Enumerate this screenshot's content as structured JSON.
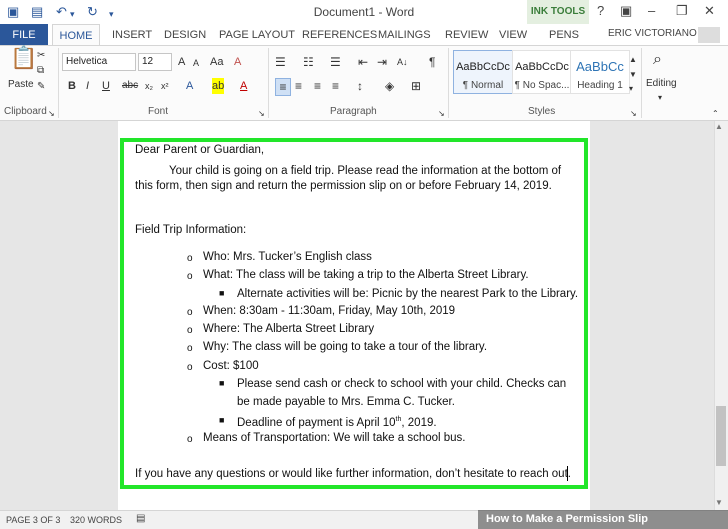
{
  "title_bar": {
    "document_title": "Document1 - Word",
    "ink_tools": "INK TOOLS",
    "help": "?"
  },
  "tabs": [
    "FILE",
    "HOME",
    "INSERT",
    "DESIGN",
    "PAGE LAYOUT",
    "REFERENCES",
    "MAILINGS",
    "REVIEW",
    "VIEW",
    "PENS"
  ],
  "user": "ERIC VICTORIANO",
  "ribbon": {
    "clipboard": {
      "paste_label": "Paste",
      "group_label": "Clipboard"
    },
    "font": {
      "font_name": "Helvetica",
      "font_size": "12",
      "bold": "B",
      "italic": "I",
      "underline": "U",
      "group_label": "Font"
    },
    "paragraph": {
      "group_label": "Paragraph"
    },
    "styles": {
      "items": [
        {
          "sample": "AaBbCcDc",
          "name": "¶ Normal"
        },
        {
          "sample": "AaBbCcDc",
          "name": "¶ No Spac..."
        },
        {
          "sample": "AaBbCc",
          "name": "Heading 1"
        }
      ],
      "group_label": "Styles"
    },
    "editing": {
      "label": "Editing"
    }
  },
  "document": {
    "salutation": "Dear Parent or Guardian,",
    "intro_line1": "Your child is going on a field trip. Please read the information at the bottom of",
    "intro_line2": "this form, then sign and return the permission slip on or before February 14, 2019.",
    "section_heading": "Field Trip Information:",
    "who": "Who: Mrs. Tucker’s English class",
    "what": "What: The class will be taking a trip to the Alberta Street Library.",
    "alternate": "Alternate activities will be: Picnic by the nearest Park to the Library.",
    "when": "When: 8:30am - 11:30am, Friday, May 10th, 2019",
    "where": "Where: The Alberta Street Library",
    "why": "Why: The class will be going to take a tour of the library.",
    "cost": "Cost: $100",
    "cash_line1": "Please send cash or check to school with your child. Checks can",
    "cash_line2": "be made payable to Mrs. Emma C. Tucker.",
    "deadline_pre": "Deadline of payment is April 10",
    "deadline_sup": "th",
    "deadline_post": ", 2019.",
    "transport": "Means of Transportation: We will take a school bus.",
    "closing": "If you have any questions or would like further information, don’t hesitate to reach out."
  },
  "status_bar": {
    "page": "PAGE 3 OF 3",
    "words": "320 WORDS"
  },
  "watermark": "How to Make a Permission Slip",
  "colors": {
    "accent": "#2b579a",
    "highlight": "#22e62a",
    "ink_tools": "#3a7d3a"
  }
}
